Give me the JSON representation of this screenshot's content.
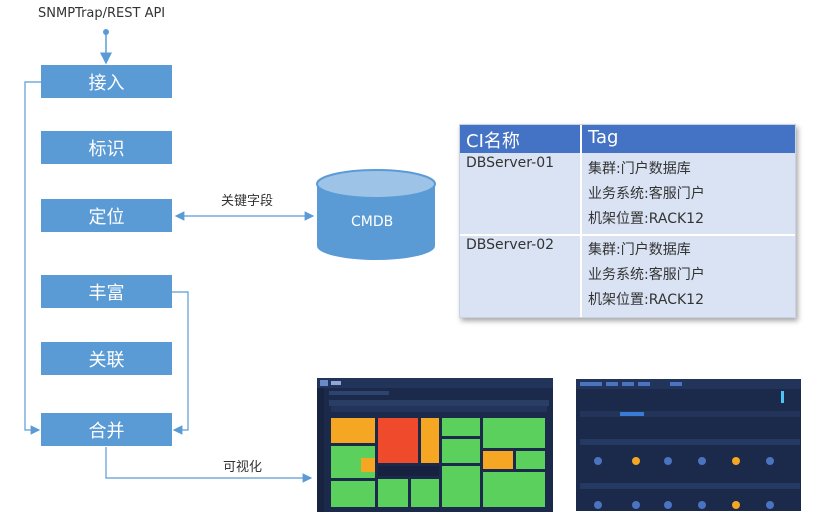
{
  "source_label": "SNMPTrap/REST API",
  "steps": [
    "接入",
    "标识",
    "定位",
    "丰富",
    "关联",
    "合并"
  ],
  "keyfield_label": "关键字段",
  "cmdb_label": "CMDB",
  "visualize_label": "可视化",
  "table": {
    "col_ci": "CI名称",
    "col_tag": "Tag",
    "rows": [
      {
        "name": "DBServer-01",
        "tags": [
          "集群:门户数据库",
          "业务系统:客服门户",
          "机架位置:RACK12"
        ]
      },
      {
        "name": "DBServer-02",
        "tags": [
          "集群:门户数据库",
          "业务系统:客服门户",
          "机架位置:RACK12"
        ]
      }
    ]
  },
  "colors": {
    "step_fill": "#5b9bd5",
    "line": "#5b9bd5",
    "cmdb_fill": "#5b9bd5",
    "cmdb_top": "#9dc3e6",
    "table_header": "#4472c4",
    "table_body": "#dae3f3",
    "heatmap_red": "#ee4a2b",
    "heatmap_orange": "#f5a623",
    "heatmap_green": "#5cd05c",
    "dashboard_bg": "#1b2a4a"
  }
}
